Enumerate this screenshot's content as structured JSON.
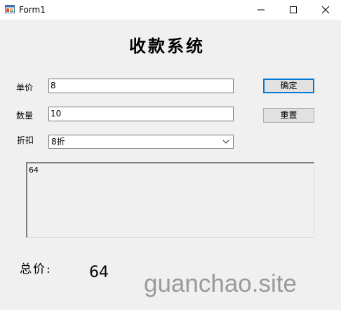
{
  "window": {
    "title": "Form1"
  },
  "form": {
    "heading": "收款系统",
    "unit_price": {
      "label": "单价",
      "value": "8"
    },
    "quantity": {
      "label": "数量",
      "value": "10"
    },
    "discount": {
      "label": "折扣",
      "selected": "8折"
    },
    "buttons": {
      "confirm": "确定",
      "reset": "重置"
    },
    "output_text": "64",
    "total": {
      "label": "总价:",
      "value": "64"
    }
  },
  "watermark": "guanchao.site",
  "colors": {
    "accent": "#0078d7",
    "background": "#f0f0f0",
    "watermark": "#9a9a9a"
  }
}
